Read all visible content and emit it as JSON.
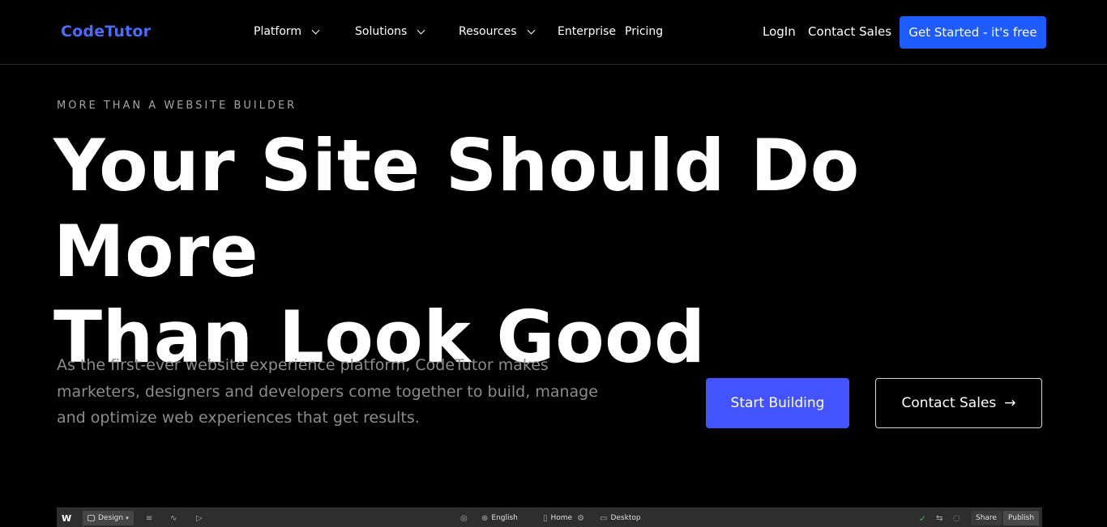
{
  "nav": {
    "brand": "CodeTutor",
    "menu": [
      {
        "label": "Platform"
      },
      {
        "label": "Solutions"
      },
      {
        "label": "Resources"
      }
    ],
    "links": [
      "Enterprise",
      "Pricing"
    ],
    "login": "LogIn",
    "contact": "Contact Sales",
    "cta": "Get Started - it's free"
  },
  "hero": {
    "eyebrow": "MORE THAN A WEBSITE BUILDER",
    "title_line1": "Your Site Should Do More",
    "title_line2": "Than Look Good",
    "subtitle": "As the first-ever website experience platform, CodeTutor makes marketers, designers and developers come together to build, manage and optimize web experiences that get results.",
    "primary_button": "Start Building",
    "secondary_button": "Contact Sales",
    "secondary_icon": "arrow-right-icon"
  },
  "editor": {
    "logo": "W",
    "mode": "Design",
    "language": "English",
    "page": "Home",
    "breakpoint": "Desktop",
    "share": "Share",
    "publish": "Publish"
  },
  "colors": {
    "brand": "#4a6cf7",
    "cta_top": "#1f5cff",
    "primary_button": "#4353ff",
    "background": "#000000"
  }
}
